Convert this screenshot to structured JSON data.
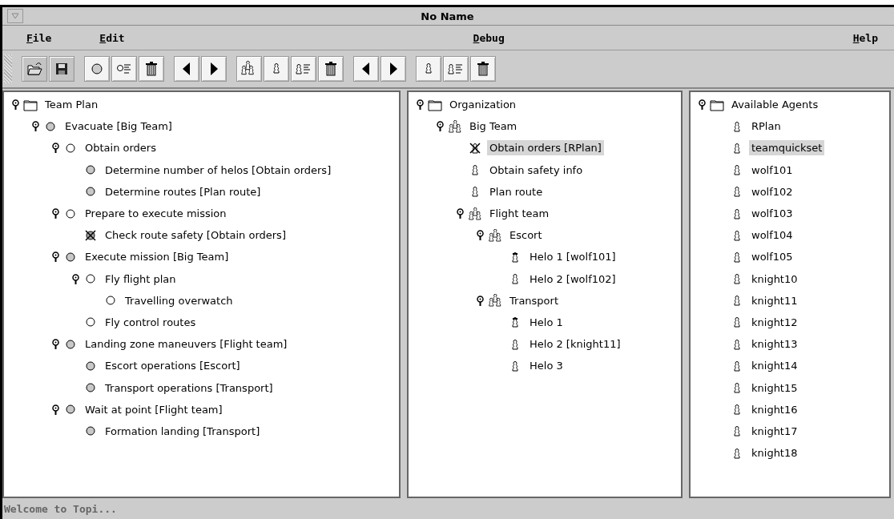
{
  "window": {
    "title": "No Name"
  },
  "menu": {
    "left": [
      {
        "label": "File"
      },
      {
        "label": "Edit"
      }
    ],
    "center": [
      {
        "label": "Debug"
      }
    ],
    "right": [
      {
        "label": "Help"
      }
    ]
  },
  "toolbar": [
    {
      "buttons": [
        {
          "kind": "open",
          "disabled": true
        },
        {
          "kind": "save",
          "disabled": true
        }
      ]
    },
    {
      "buttons": [
        {
          "kind": "task",
          "disabled": false
        },
        {
          "kind": "task-list",
          "disabled": false
        },
        {
          "kind": "delete",
          "disabled": false
        }
      ]
    },
    {
      "buttons": [
        {
          "kind": "prev",
          "disabled": false
        },
        {
          "kind": "next",
          "disabled": false
        }
      ]
    },
    {
      "buttons": [
        {
          "kind": "team",
          "disabled": false
        },
        {
          "kind": "agent",
          "disabled": false
        },
        {
          "kind": "agent-list",
          "disabled": false
        },
        {
          "kind": "delete",
          "disabled": false
        }
      ]
    },
    {
      "buttons": [
        {
          "kind": "prev",
          "disabled": false
        },
        {
          "kind": "next",
          "disabled": false
        }
      ]
    },
    {
      "buttons": [
        {
          "kind": "agent",
          "disabled": false
        },
        {
          "kind": "agent-list",
          "disabled": false
        },
        {
          "kind": "delete",
          "disabled": false
        }
      ]
    }
  ],
  "panes": [
    {
      "tree": {
        "label": "Team Plan",
        "kind": "folder",
        "expanded": true,
        "selected": false,
        "children": [
          {
            "label": "Evacuate [Big Team]",
            "kind": "task-assigned",
            "expanded": true,
            "selected": false,
            "children": [
              {
                "label": "Obtain orders",
                "kind": "task",
                "expanded": true,
                "selected": false,
                "children": [
                  {
                    "label": "Determine number of helos [Obtain orders]",
                    "kind": "task-assigned",
                    "selected": false
                  },
                  {
                    "label": "Determine routes [Plan route]",
                    "kind": "task-assigned",
                    "selected": false
                  }
                ]
              },
              {
                "label": "Prepare to execute mission",
                "kind": "task",
                "expanded": true,
                "selected": false,
                "children": [
                  {
                    "label": "Check route safety [Obtain orders]",
                    "kind": "task-failed",
                    "selected": false
                  }
                ]
              },
              {
                "label": "Execute mission [Big Team]",
                "kind": "task-assigned",
                "expanded": true,
                "selected": false,
                "children": [
                  {
                    "label": "Fly flight plan",
                    "kind": "task",
                    "expanded": true,
                    "selected": false,
                    "children": [
                      {
                        "label": "Travelling overwatch",
                        "kind": "task",
                        "selected": false
                      }
                    ]
                  },
                  {
                    "label": "Fly control routes",
                    "kind": "task",
                    "selected": false
                  }
                ]
              },
              {
                "label": "Landing zone maneuvers [Flight team]",
                "kind": "task-assigned",
                "expanded": true,
                "selected": false,
                "children": [
                  {
                    "label": "Escort operations [Escort]",
                    "kind": "task-assigned",
                    "selected": false
                  },
                  {
                    "label": "Transport operations [Transport]",
                    "kind": "task-assigned",
                    "selected": false
                  }
                ]
              },
              {
                "label": "Wait at point [Flight team]",
                "kind": "task-assigned",
                "expanded": true,
                "selected": false,
                "children": [
                  {
                    "label": "Formation landing [Transport]",
                    "kind": "task-assigned",
                    "selected": false
                  }
                ]
              }
            ]
          }
        ]
      }
    },
    {
      "tree": {
        "label": "Organization",
        "kind": "folder",
        "expanded": true,
        "selected": false,
        "children": [
          {
            "label": "Big Team",
            "kind": "team",
            "expanded": true,
            "selected": false,
            "children": [
              {
                "label": "Obtain orders [RPlan]",
                "kind": "agent-failed",
                "selected": true
              },
              {
                "label": "Obtain safety info",
                "kind": "agent",
                "selected": false
              },
              {
                "label": "Plan route",
                "kind": "agent",
                "selected": false
              },
              {
                "label": "Flight team",
                "kind": "team",
                "expanded": true,
                "selected": false,
                "children": [
                  {
                    "label": "Escort",
                    "kind": "team",
                    "expanded": true,
                    "selected": false,
                    "children": [
                      {
                        "label": "Helo 1 [wolf101]",
                        "kind": "agent-leader",
                        "selected": false
                      },
                      {
                        "label": "Helo 2 [wolf102]",
                        "kind": "agent",
                        "selected": false
                      }
                    ]
                  },
                  {
                    "label": "Transport",
                    "kind": "team",
                    "expanded": true,
                    "selected": false,
                    "children": [
                      {
                        "label": "Helo 1",
                        "kind": "agent-leader",
                        "selected": false
                      },
                      {
                        "label": "Helo 2 [knight11]",
                        "kind": "agent",
                        "selected": false
                      },
                      {
                        "label": "Helo 3",
                        "kind": "agent",
                        "selected": false
                      }
                    ]
                  }
                ]
              }
            ]
          }
        ]
      }
    },
    {
      "tree": {
        "label": "Available Agents",
        "kind": "folder",
        "expanded": true,
        "selected": false,
        "children": [
          {
            "label": "RPlan",
            "kind": "agent",
            "selected": false
          },
          {
            "label": "teamquickset",
            "kind": "agent",
            "selected": true
          },
          {
            "label": "wolf101",
            "kind": "agent",
            "selected": false
          },
          {
            "label": "wolf102",
            "kind": "agent",
            "selected": false
          },
          {
            "label": "wolf103",
            "kind": "agent",
            "selected": false
          },
          {
            "label": "wolf104",
            "kind": "agent",
            "selected": false
          },
          {
            "label": "wolf105",
            "kind": "agent",
            "selected": false
          },
          {
            "label": "knight10",
            "kind": "agent",
            "selected": false
          },
          {
            "label": "knight11",
            "kind": "agent",
            "selected": false
          },
          {
            "label": "knight12",
            "kind": "agent",
            "selected": false
          },
          {
            "label": "knight13",
            "kind": "agent",
            "selected": false
          },
          {
            "label": "knight14",
            "kind": "agent",
            "selected": false
          },
          {
            "label": "knight15",
            "kind": "agent",
            "selected": false
          },
          {
            "label": "knight16",
            "kind": "agent",
            "selected": false
          },
          {
            "label": "knight17",
            "kind": "agent",
            "selected": false
          },
          {
            "label": "knight18",
            "kind": "agent",
            "selected": false
          }
        ]
      }
    }
  ],
  "status_bar": {
    "text": "Welcome to Topi..."
  }
}
